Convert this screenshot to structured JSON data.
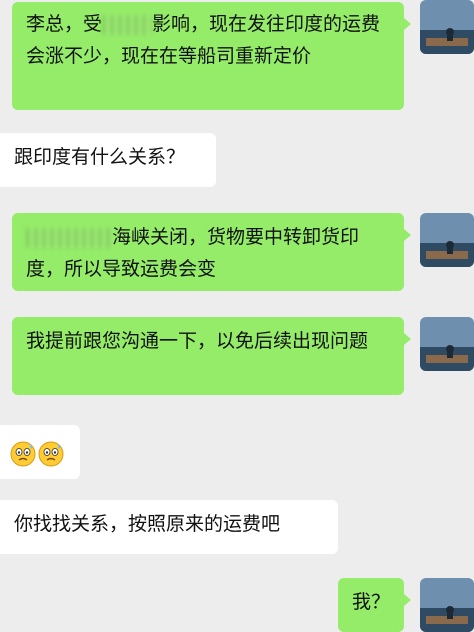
{
  "messages": [
    {
      "side": "out",
      "text_a": "李总，受",
      "text_b": "影响，现在发往印度的运费会涨不少，现在在等船司重新定价"
    },
    {
      "side": "in",
      "text": "跟印度有什么关系？"
    },
    {
      "side": "out",
      "text": "海峡关闭，货物要中转卸货印度，所以导致运费会变"
    },
    {
      "side": "out",
      "text": "我提前跟您沟通一下，以免后续出现问题"
    },
    {
      "side": "in",
      "emojis": [
        "flushed-face-with-sweat",
        "flushed-face-with-sweat"
      ]
    },
    {
      "side": "in",
      "text": "你找找关系，按照原来的运费吧"
    },
    {
      "side": "out",
      "text": "我？"
    }
  ],
  "colors": {
    "background": "#ededed",
    "outgoing_bubble": "#95ec69",
    "incoming_bubble": "#ffffff"
  }
}
